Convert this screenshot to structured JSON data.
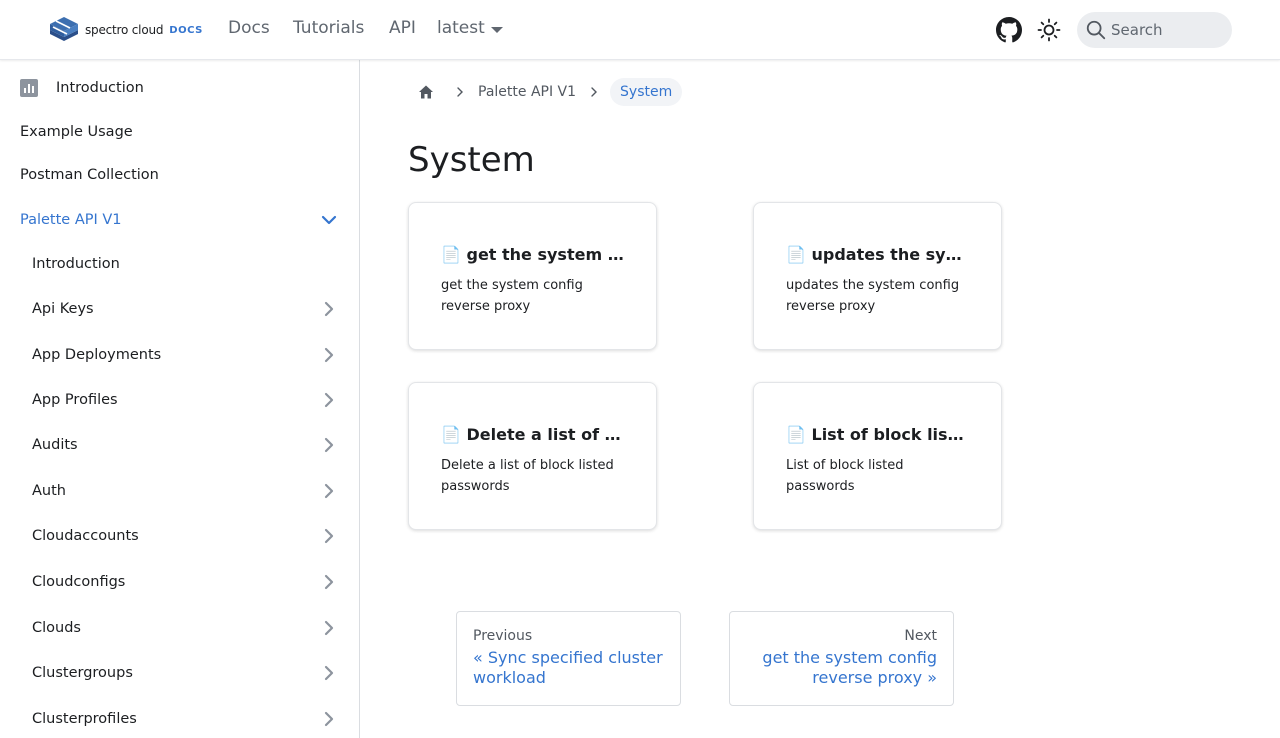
{
  "header": {
    "logo_text": "spectro cloud",
    "logo_badge": "DOCS",
    "nav": [
      "Docs",
      "Tutorials",
      "API"
    ],
    "version": "latest",
    "search_placeholder": "Search"
  },
  "sidebar": {
    "top_items": [
      "Introduction",
      "Example Usage",
      "Postman Collection"
    ],
    "active_section": "Palette API V1",
    "sub_items": [
      "Introduction",
      "Api Keys",
      "App Deployments",
      "App Profiles",
      "Audits",
      "Auth",
      "Cloudaccounts",
      "Cloudconfigs",
      "Clouds",
      "Clustergroups",
      "Clusterprofiles"
    ]
  },
  "breadcrumb": {
    "parent": "Palette API V1",
    "current": "System"
  },
  "page": {
    "title": "System"
  },
  "cards": [
    {
      "title": "📄 get the system config reverse proxy",
      "description": "get the system config reverse proxy"
    },
    {
      "title": "📄 updates the system config reverse proxy",
      "description": "updates the system config reverse proxy"
    },
    {
      "title": "📄 Delete a list of block listed passwords",
      "description": "Delete a list of block listed passwords"
    },
    {
      "title": "📄 List of block listed passwords",
      "description": "List of block listed passwords"
    }
  ],
  "pagination": {
    "prev_sub": "Previous",
    "prev_label": "« Sync specified cluster workload",
    "next_sub": "Next",
    "next_label": "get the system config reverse proxy »"
  },
  "colors": {
    "accent": "#3575cf",
    "text": "#1c1e21",
    "muted": "#606770"
  }
}
